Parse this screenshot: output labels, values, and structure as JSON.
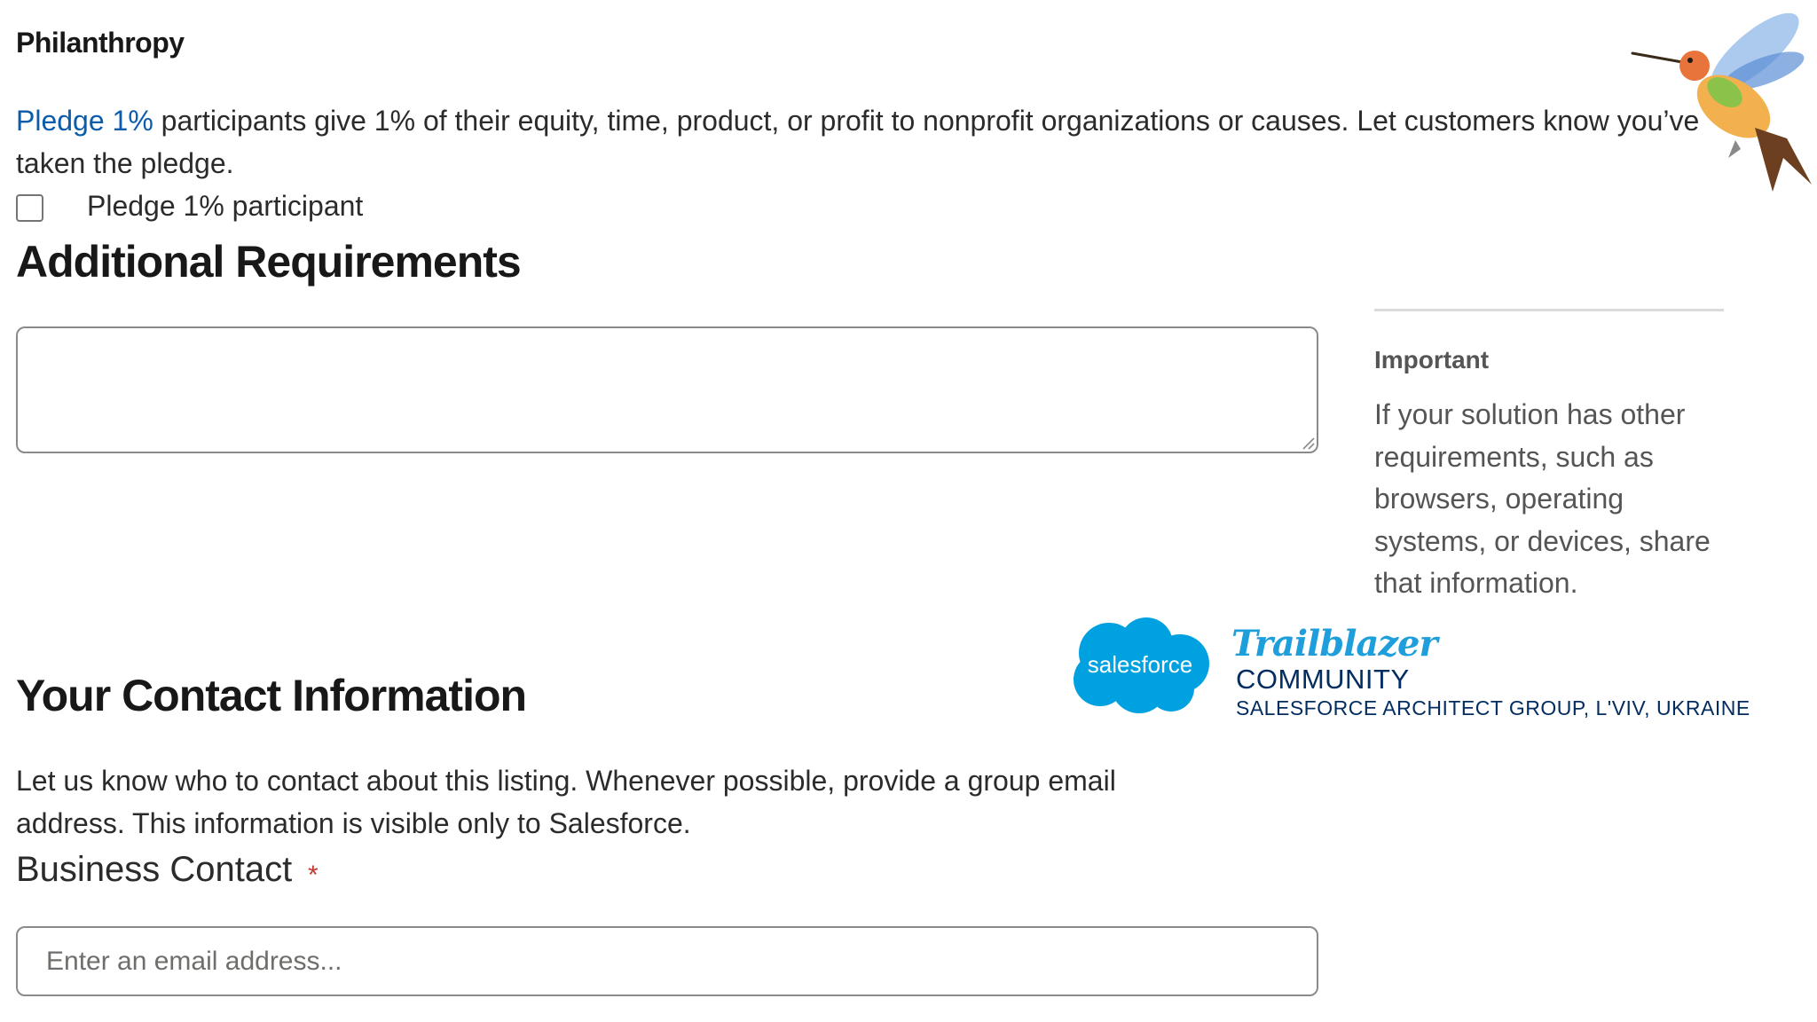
{
  "philanthropy": {
    "title": "Philanthropy",
    "pledge_link": "Pledge 1%",
    "description_rest": " participants give 1% of their equity, time, product, or profit to nonprofit organizations or causes. Let customers know you’ve taken the pledge.",
    "checkbox_label": "Pledge 1% participant",
    "checkbox_checked": false
  },
  "additional_requirements": {
    "heading": "Additional Requirements",
    "textarea_value": ""
  },
  "aside": {
    "title": "Important",
    "body": "If your solution has other requirements, such as browsers, operating systems, or devices, share that information."
  },
  "branding": {
    "cloud_text": "salesforce",
    "trailblazer": "Trailblazer",
    "community": "COMMUNITY",
    "group": "SALESFORCE ARCHITECT GROUP, L'VIV, UKRAINE",
    "cloud_color": "#00a1e0",
    "navy_color": "#032d60"
  },
  "contact": {
    "heading": "Your Contact Information",
    "description": "Let us know who to contact about this listing. Whenever possible, provide a group email address. This information is visible only to Salesforce.",
    "business_contact_label": "Business Contact",
    "required_marker": "*",
    "email_placeholder": "Enter an email address...",
    "email_value": ""
  },
  "colors": {
    "link": "#0b5cab",
    "required": "#c23934"
  }
}
